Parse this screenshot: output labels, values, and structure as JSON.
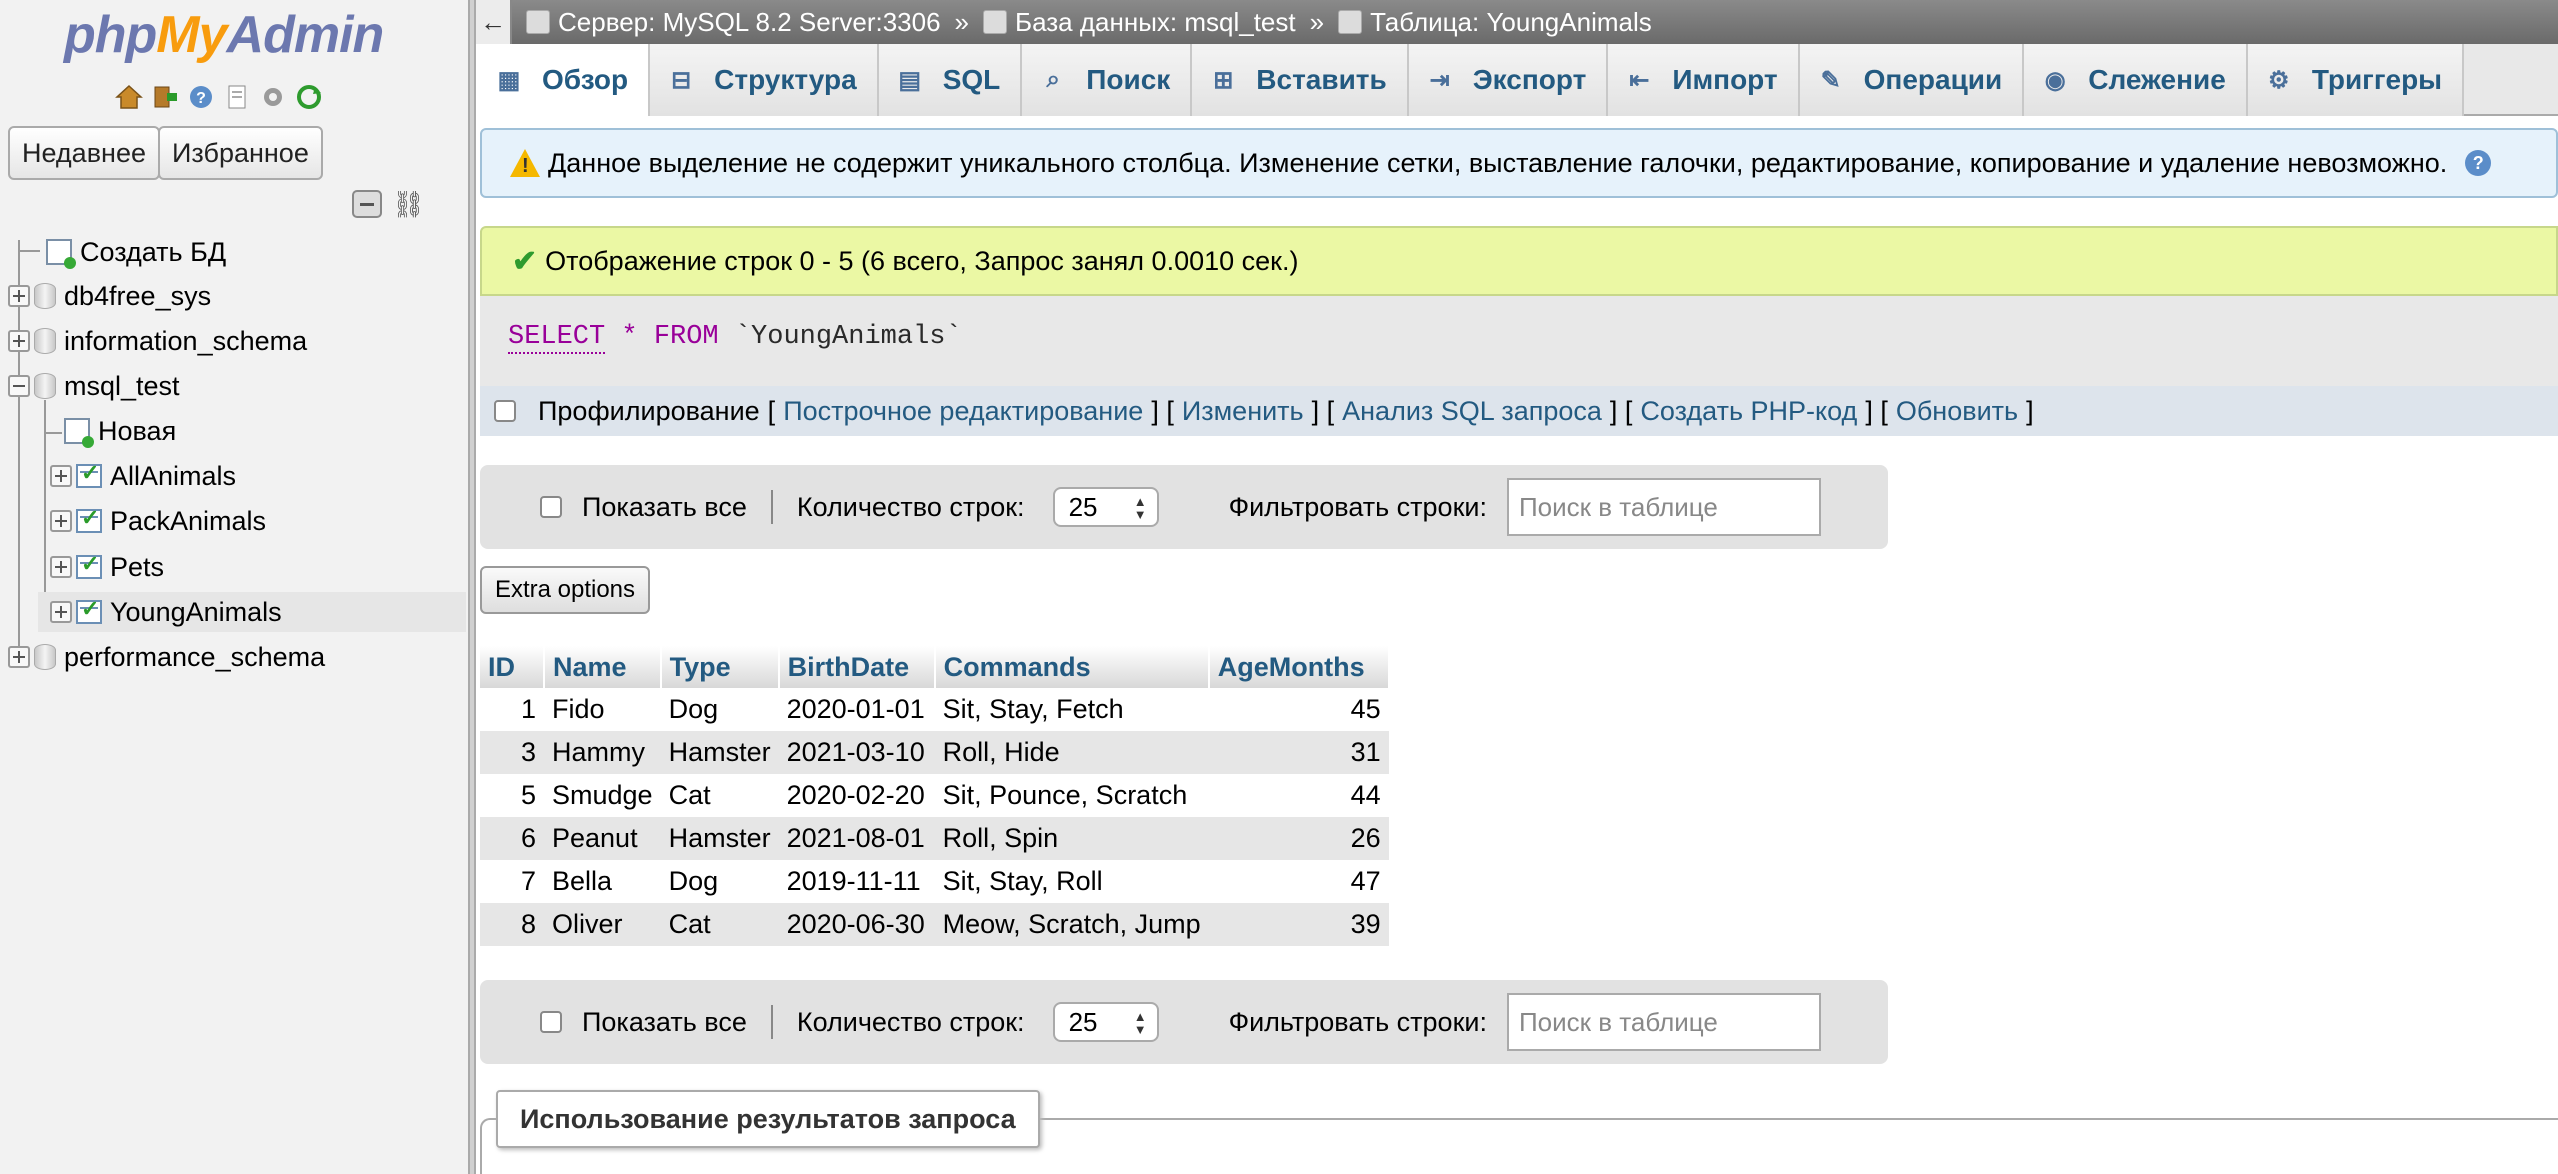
{
  "logo": {
    "php": "php",
    "my": "My",
    "admin": "Admin"
  },
  "nav": {
    "recent": "Недавнее",
    "favorites": "Избранное",
    "tree": {
      "create_db": "Создать БД",
      "db4free_sys": "db4free_sys",
      "information_schema": "information_schema",
      "msql_test": "msql_test",
      "new": "Новая",
      "allanimals": "AllAnimals",
      "packanimals": "PackAnimals",
      "pets": "Pets",
      "younganimals": "YoungAnimals",
      "performance_schema": "performance_schema"
    }
  },
  "breadcrumb": {
    "server": "Сервер: MySQL 8.2 Server:3306",
    "database": "База данных: msql_test",
    "table": "Таблица: YoungAnimals",
    "separator": "»"
  },
  "tabs": [
    {
      "label": "Обзор",
      "icon": "browse-icon",
      "active": true
    },
    {
      "label": "Структура",
      "icon": "structure-icon"
    },
    {
      "label": "SQL",
      "icon": "sql-icon"
    },
    {
      "label": "Поиск",
      "icon": "search-icon"
    },
    {
      "label": "Вставить",
      "icon": "insert-icon"
    },
    {
      "label": "Экспорт",
      "icon": "export-icon"
    },
    {
      "label": "Импорт",
      "icon": "import-icon"
    },
    {
      "label": "Операции",
      "icon": "operations-icon"
    },
    {
      "label": "Слежение",
      "icon": "tracking-icon"
    },
    {
      "label": "Триггеры",
      "icon": "triggers-icon"
    }
  ],
  "notice": "Данное выделение не содержит уникального столбца. Изменение сетки, выставление галочки, редактирование, копирование и удаление невозможно.",
  "success": "Отображение строк 0 - 5 (6 всего, Запрос занял 0.0010 сек.)",
  "sql": {
    "select": "SELECT",
    "star": "*",
    "from": "FROM",
    "table": "`YoungAnimals`"
  },
  "profiling": {
    "label": "Профилирование",
    "inline_edit": "Построчное редактирование",
    "edit": "Изменить",
    "explain": "Анализ SQL запроса",
    "php_code": "Создать PHP-код",
    "refresh": "Обновить",
    "open": "[",
    "close": "]",
    "between": "] ["
  },
  "navbar": {
    "show_all": "Показать все",
    "rows_label": "Количество строк:",
    "rows_value": "25",
    "filter_label": "Фильтровать строки:",
    "filter_placeholder": "Поиск в таблице"
  },
  "extra_options": "Extra options",
  "table": {
    "columns": [
      "ID",
      "Name",
      "Type",
      "BirthDate",
      "Commands",
      "AgeMonths"
    ],
    "rows": [
      [
        "1",
        "Fido",
        "Dog",
        "2020-01-01",
        "Sit, Stay, Fetch",
        "45"
      ],
      [
        "3",
        "Hammy",
        "Hamster",
        "2021-03-10",
        "Roll, Hide",
        "31"
      ],
      [
        "5",
        "Smudge",
        "Cat",
        "2020-02-20",
        "Sit, Pounce, Scratch",
        "44"
      ],
      [
        "6",
        "Peanut",
        "Hamster",
        "2021-08-01",
        "Roll, Spin",
        "26"
      ],
      [
        "7",
        "Bella",
        "Dog",
        "2019-11-11",
        "Sit, Stay, Roll",
        "47"
      ],
      [
        "8",
        "Oliver",
        "Cat",
        "2020-06-30",
        "Meow, Scratch, Jump",
        "39"
      ]
    ]
  },
  "query_results_legend": "Использование результатов запроса",
  "colors": {
    "link": "#235a81",
    "notice_bg": "#e6f2fb",
    "success_bg": "#ebf8a4",
    "keyword": "#990099"
  }
}
